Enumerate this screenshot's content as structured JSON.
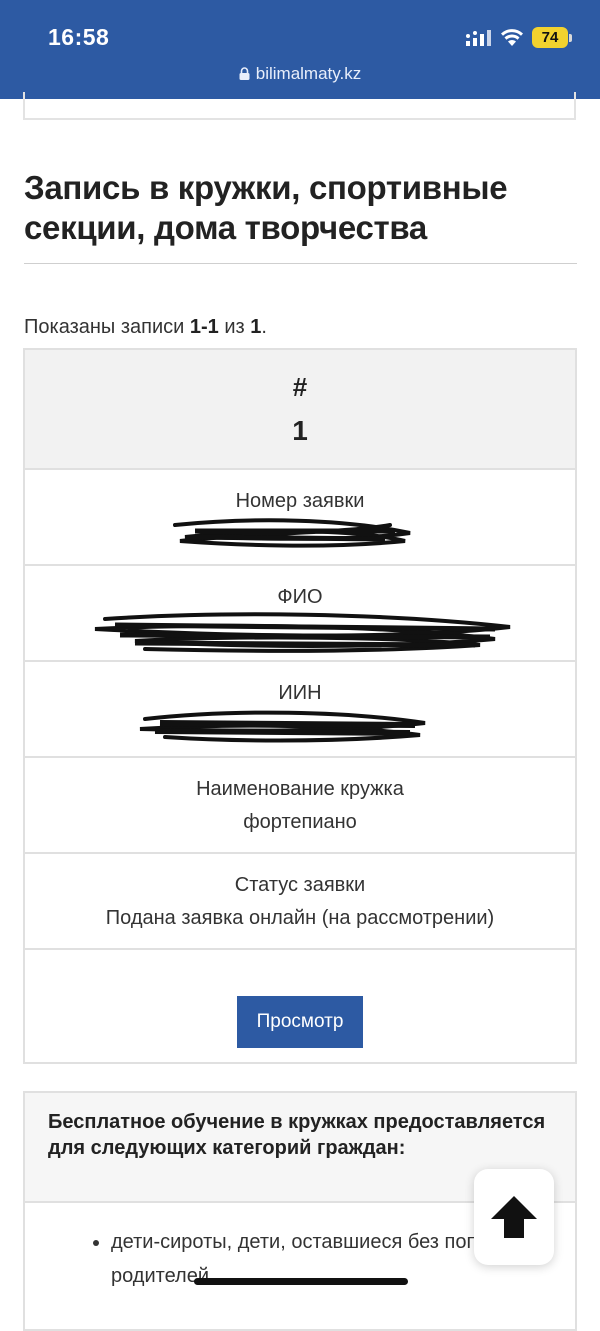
{
  "status_bar": {
    "time": "16:58",
    "battery": "74"
  },
  "browser": {
    "url": "bilimalmaty.kz"
  },
  "page": {
    "title": "Запись в кружки, спортивные секции, дома творчества",
    "summary": {
      "prefix": "Показаны записи ",
      "range": "1-1",
      "middle": " из ",
      "total": "1",
      "suffix": "."
    }
  },
  "table": {
    "header_label": "#",
    "row_number": "1",
    "fields": {
      "application_number_label": "Номер заявки",
      "fio_label": "ФИО",
      "iin_label": "ИИН",
      "club_name_label": "Наименование кружка",
      "club_name_value": "фортепиано",
      "status_label": "Статус заявки",
      "status_value": "Подана заявка онлайн (на рассмотрении)"
    },
    "view_button": "Просмотр"
  },
  "info": {
    "heading": "Бесплатное обучение в кружках предоставляется для следующих категорий граждан:",
    "items": [
      "дети-сироты, дети, оставшиеся без попечения родителей"
    ]
  },
  "colors": {
    "brand": "#2d5aa3",
    "battery": "#f2d22e"
  },
  "icons": {
    "scroll_top": "arrow-up-icon",
    "lock": "lock-icon"
  }
}
